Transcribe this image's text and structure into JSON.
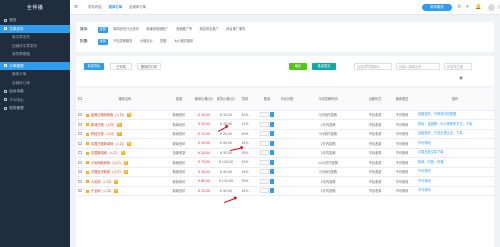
{
  "sidebar": {
    "logo": "全伴播",
    "items": [
      {
        "label": "首页",
        "type": "top"
      },
      {
        "label": "文章发布",
        "type": "top-active"
      },
      {
        "label": "新文章发布",
        "type": "sub"
      },
      {
        "label": "旧媒体文章发布",
        "type": "sub"
      },
      {
        "label": "我的草稿箱",
        "type": "sub"
      },
      {
        "label": "订单管理",
        "type": "top-active2"
      },
      {
        "label": "媒体订单",
        "type": "sub"
      },
      {
        "label": "自媒体订单",
        "type": "sub"
      },
      {
        "label": "后台功能",
        "type": "top"
      },
      {
        "label": "个人中心",
        "type": "top"
      },
      {
        "label": "财务管理",
        "type": "top"
      }
    ]
  },
  "topbar": {
    "tabs": [
      "发布内容",
      "媒体订单",
      "自媒体订单"
    ],
    "active_tab": 1,
    "vip_label": "新享服务"
  },
  "filters": {
    "row1_label": "媒体:",
    "row1_options": [
      "全部",
      "新闻资讯行业资讯",
      "新媒体营销推广",
      "营销推广号",
      "网站排名推广",
      "综合推广服务"
    ],
    "row2_label": "配置:",
    "row2_options": [
      "全部",
      "不包发稿服务",
      "价格定价",
      "配套",
      "大价格总媒体"
    ]
  },
  "actions": {
    "btn_primary": "批量导出",
    "btn_secondary": "已完成",
    "btn_tertiary": "删除的订单",
    "btn_green": "确定",
    "btn_blue": "批量提交",
    "select_placeholder": "请选择所属媒体",
    "input_placeholder": "请输入媒体名称",
    "input_placeholder2": "请选择日期"
  },
  "table": {
    "headers": [
      "",
      "媒体名称",
      "渠道",
      "媒体价格(元)",
      "成本价格(元)",
      "折扣",
      "数量",
      "平台分配",
      "平均发稿时间",
      "出稿形式",
      "媒体属性",
      "操作"
    ],
    "rows": [
      {
        "name": "金融日报网络版（入口）",
        "channel": "新闻资讯",
        "p1": "¥ 10.00",
        "p2": "¥ 30.00",
        "pct": "50%",
        "time": "5分钟内发稿",
        "type": "不包收录",
        "attr": "不可修改",
        "ops": "金融相关，可修改内容配图"
      },
      {
        "name": "新闻日报（入口）",
        "channel": "新闻资讯",
        "p1": "¥ 20.00",
        "p2": "¥ 35.00",
        "pct": "41%",
        "time": "2天内发稿",
        "type": "不包收录",
        "attr": "不可修改",
        "ops": "财经，金融等，可以带联系方式，下单"
      },
      {
        "name": "财经日报（入口）",
        "channel": "新闻资讯",
        "p1": "¥ 15.00",
        "p2": "¥ 20.00",
        "pct": "50%",
        "time": "5分钟内发稿",
        "type": "不包收录",
        "attr": "不可修改",
        "ops": "金融相关，只发正规企业，下单"
      },
      {
        "name": "中国日报新闻网（入口）",
        "channel": "新闻资讯",
        "p1": "¥ 50.00",
        "p2": "¥ 45.00",
        "pct": "45%",
        "time": "2天内发稿",
        "type": "不包收录",
        "attr": "不可修改",
        "ops": "不可修改"
      },
      {
        "name": "中国新闻网（入口）",
        "channel": "百度收录",
        "p1": "¥ 20.00",
        "p2": "¥ 35.00",
        "pct": "55%",
        "time": "2天内发稿",
        "type": "不包收录",
        "attr": "不可修改",
        "ops": "中国日报文章下单"
      },
      {
        "name": "人民网新闻网（入口）",
        "channel": "新闻资讯",
        "p1": "¥ 75.00",
        "p2": "¥ 125.00",
        "pct": "50%",
        "time": "12小时内发稿",
        "type": "不包收录",
        "attr": "不可修改",
        "ops": "新闻，时政，科普"
      },
      {
        "name": "中国经济新闻（入口）",
        "channel": "新闻资讯",
        "p1": "¥ 30.00",
        "p2": "¥ 40.00",
        "pct": "45%",
        "time": "5分钟内发稿",
        "type": "不包收录",
        "attr": "不可修改",
        "ops": "不可修改"
      },
      {
        "name": "人民网（入口）",
        "channel": "新闻资讯",
        "p1": "¥ 80.00",
        "p2": "¥ 125.00",
        "pct": "55%",
        "time": "2天内发稿",
        "type": "不包收录",
        "attr": "不可修改",
        "ops": "不可修改"
      },
      {
        "name": "千龙网（入口）",
        "channel": "新闻资讯",
        "p1": "¥ 25.00",
        "p2": "¥ 40.00",
        "pct": "45%",
        "time": "2天内发稿",
        "type": "不包收录",
        "attr": "不可修改",
        "ops": "不可修改"
      }
    ]
  },
  "accent": "#2f9cf0",
  "annotation_color": "#e60012"
}
